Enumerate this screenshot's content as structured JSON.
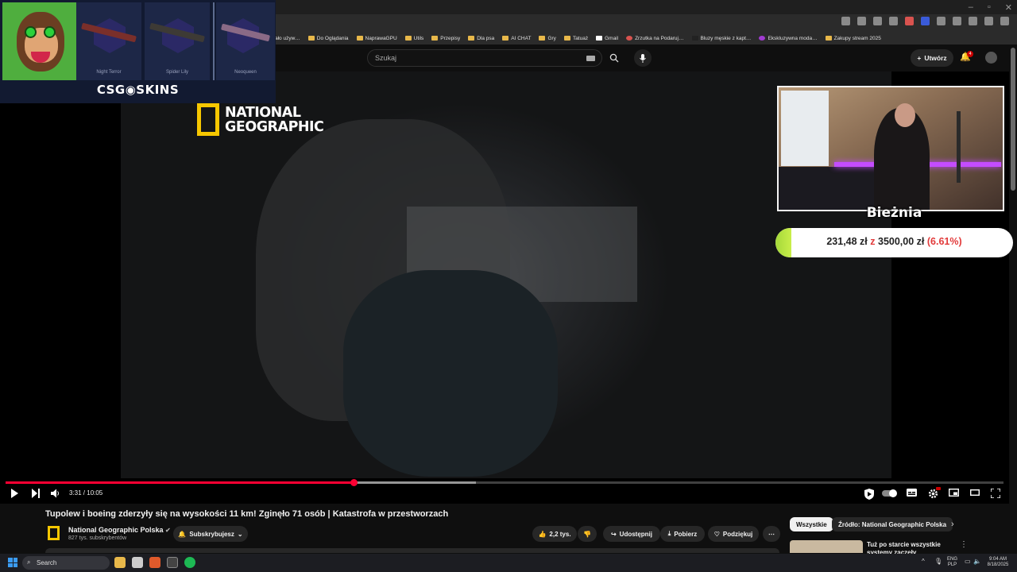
{
  "browser": {
    "window_controls": [
      "–",
      "▫",
      "✕"
    ],
    "bookmarks": [
      {
        "label": "ało używ…",
        "type": "folder"
      },
      {
        "label": "Do Oglądania",
        "type": "folder"
      },
      {
        "label": "NaprawaGPU",
        "type": "folder"
      },
      {
        "label": "Utils",
        "type": "folder"
      },
      {
        "label": "Przepisy",
        "type": "folder"
      },
      {
        "label": "Dla psa",
        "type": "folder"
      },
      {
        "label": "AI CHAT",
        "type": "folder"
      },
      {
        "label": "Gry",
        "type": "folder"
      },
      {
        "label": "Tatuaż",
        "type": "folder"
      },
      {
        "label": "Gmail",
        "type": "link"
      },
      {
        "label": "Zrzutka na Podaruj…",
        "type": "link"
      },
      {
        "label": "Bluzy męskie z kapt…",
        "type": "link"
      },
      {
        "label": "Ekskluzywna moda…",
        "type": "link"
      },
      {
        "label": "Zakupy stream 2025",
        "type": "folder"
      }
    ]
  },
  "header": {
    "search_placeholder": "Szukaj",
    "create_label": "Utwórz",
    "notifications_count": "4"
  },
  "overlay_csgo": {
    "logo": "CSG◉SKINS",
    "skins": [
      {
        "name": "Night Terror",
        "color": "#7a2f2a"
      },
      {
        "name": "Spider Lily",
        "color": "#3d3a35"
      },
      {
        "name": "Neoqueen",
        "color": "#8a6a86"
      }
    ]
  },
  "overlay_natgeo": {
    "line1": "NATIONAL",
    "line2": "GEOGRAPHIC"
  },
  "overlay_treadmill": {
    "label": "Bieżnia",
    "current": "231,48 zł",
    "separator": "z",
    "goal": "3500,00 zł",
    "percent": "(6.61%)",
    "progress_fraction": 0.0661
  },
  "player": {
    "time_display": "3:31 / 10:05",
    "played_fraction": 0.349,
    "buffered_fraction": 0.471
  },
  "video": {
    "title": "Tupolew i boeing zderzyły się na wysokości 11 km! Zginęło 71 osób | Katastrofa w przestworzach",
    "channel_name": "National Geographic Polska",
    "subscribers": "827 tys. subskrybentów",
    "subscribe_label": "Subskrybujesz",
    "likes": "2,2 tys.",
    "share_label": "Udostępnij",
    "download_label": "Pobierz",
    "thanks_label": "Podziękuj",
    "more_label": "⋯"
  },
  "sidebar": {
    "chips": [
      "Wszystkie",
      "Źródło: National Geographic Polska"
    ],
    "rec_title": "Tuż po starcie wszystkie systemy zaczęły wariować! |"
  },
  "taskbar": {
    "search_label": "Search",
    "lang_line1": "ENG",
    "lang_line2": "PLP",
    "time": "9:04 AM",
    "date": "8/18/2025"
  }
}
